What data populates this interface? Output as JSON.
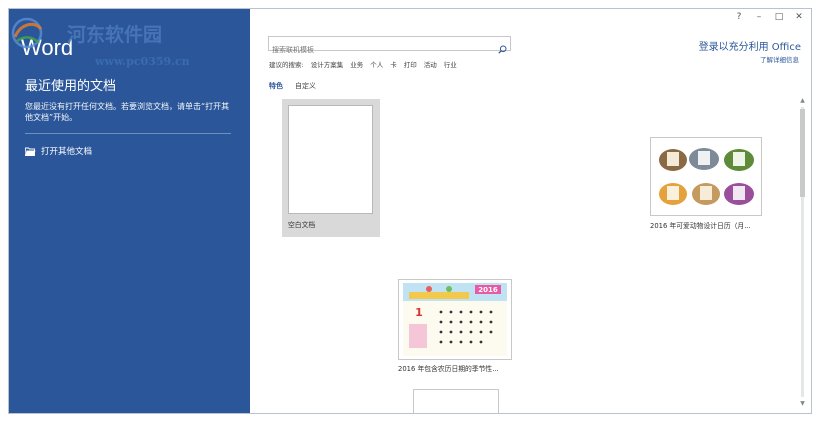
{
  "watermark": {
    "text": "河东软件园",
    "url": "www.pc0359.cn"
  },
  "left": {
    "app_title": "Word",
    "recent_heading": "最近使用的文档",
    "recent_desc": "您最近没有打开任何文档。若要浏览文档，请单击“打开其他文档”开始。",
    "open_other": "打开其他文档"
  },
  "window_controls": [
    "?",
    "–",
    "□",
    "✕"
  ],
  "search": {
    "placeholder": "搜索联机模板"
  },
  "suggestions": {
    "label": "建议的搜索:",
    "items": [
      "设计方案集",
      "业务",
      "个人",
      "卡",
      "打印",
      "活动",
      "行业"
    ]
  },
  "account": {
    "signin": "登录以充分利用 Office",
    "learn_more": "了解详细信息"
  },
  "tabs": [
    "特色",
    "自定义"
  ],
  "templates": [
    {
      "label": "空白文档"
    },
    {
      "label": "2016 年可爱动物设计日历（月..."
    },
    {
      "label": "2016 年包含农历日期的季节性..."
    }
  ],
  "calendar_thumb": {
    "year": "2016",
    "month": "1"
  },
  "colors": {
    "accent": "#2b579a",
    "watermark": "#4a78b8"
  }
}
